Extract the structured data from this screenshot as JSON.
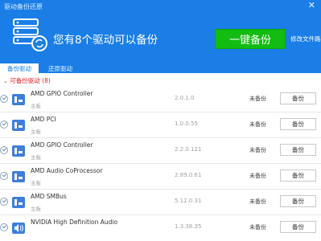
{
  "window": {
    "title": "驱动备份还原",
    "close_icon": "close-icon"
  },
  "hero": {
    "icon": "server-backup-icon",
    "headline": "您有8个驱动可以备份",
    "backup_all_label": "一键备份",
    "change_path_label": "修改文件路径"
  },
  "colors": {
    "header": "#1a7ee6",
    "primary_button": "#12bc12",
    "warning_text": "#e02020"
  },
  "tabs": [
    {
      "label": "备份驱动",
      "active": true
    },
    {
      "label": "还原驱动",
      "active": false
    }
  ],
  "section": {
    "label": "可备份驱动",
    "count": "(8)"
  },
  "devices": [
    {
      "name": "AMD GPIO Controller",
      "sub": "主板",
      "version": "2.0.1.0",
      "status": "未备份",
      "action": "备份",
      "icon": "chip-icon"
    },
    {
      "name": "AMD PCI",
      "sub": "主板",
      "version": "1.0.0.55",
      "status": "未备份",
      "action": "备份",
      "icon": "chip-icon"
    },
    {
      "name": "AMD GPIO Controller",
      "sub": "主板",
      "version": "2.2.0.121",
      "status": "未备份",
      "action": "备份",
      "icon": "chip-icon"
    },
    {
      "name": "AMD Audio CoProcessor",
      "sub": "主板",
      "version": "2.89.0.61",
      "status": "未备份",
      "action": "备份",
      "icon": "chip-icon"
    },
    {
      "name": "AMD SMBus",
      "sub": "主板",
      "version": "5.12.0.31",
      "status": "未备份",
      "action": "备份",
      "icon": "chip-icon"
    },
    {
      "name": "NVIDIA High Definition Audio",
      "sub": "",
      "version": "1.3.38.35",
      "status": "未备份",
      "action": "备份",
      "icon": "speaker-icon"
    }
  ]
}
